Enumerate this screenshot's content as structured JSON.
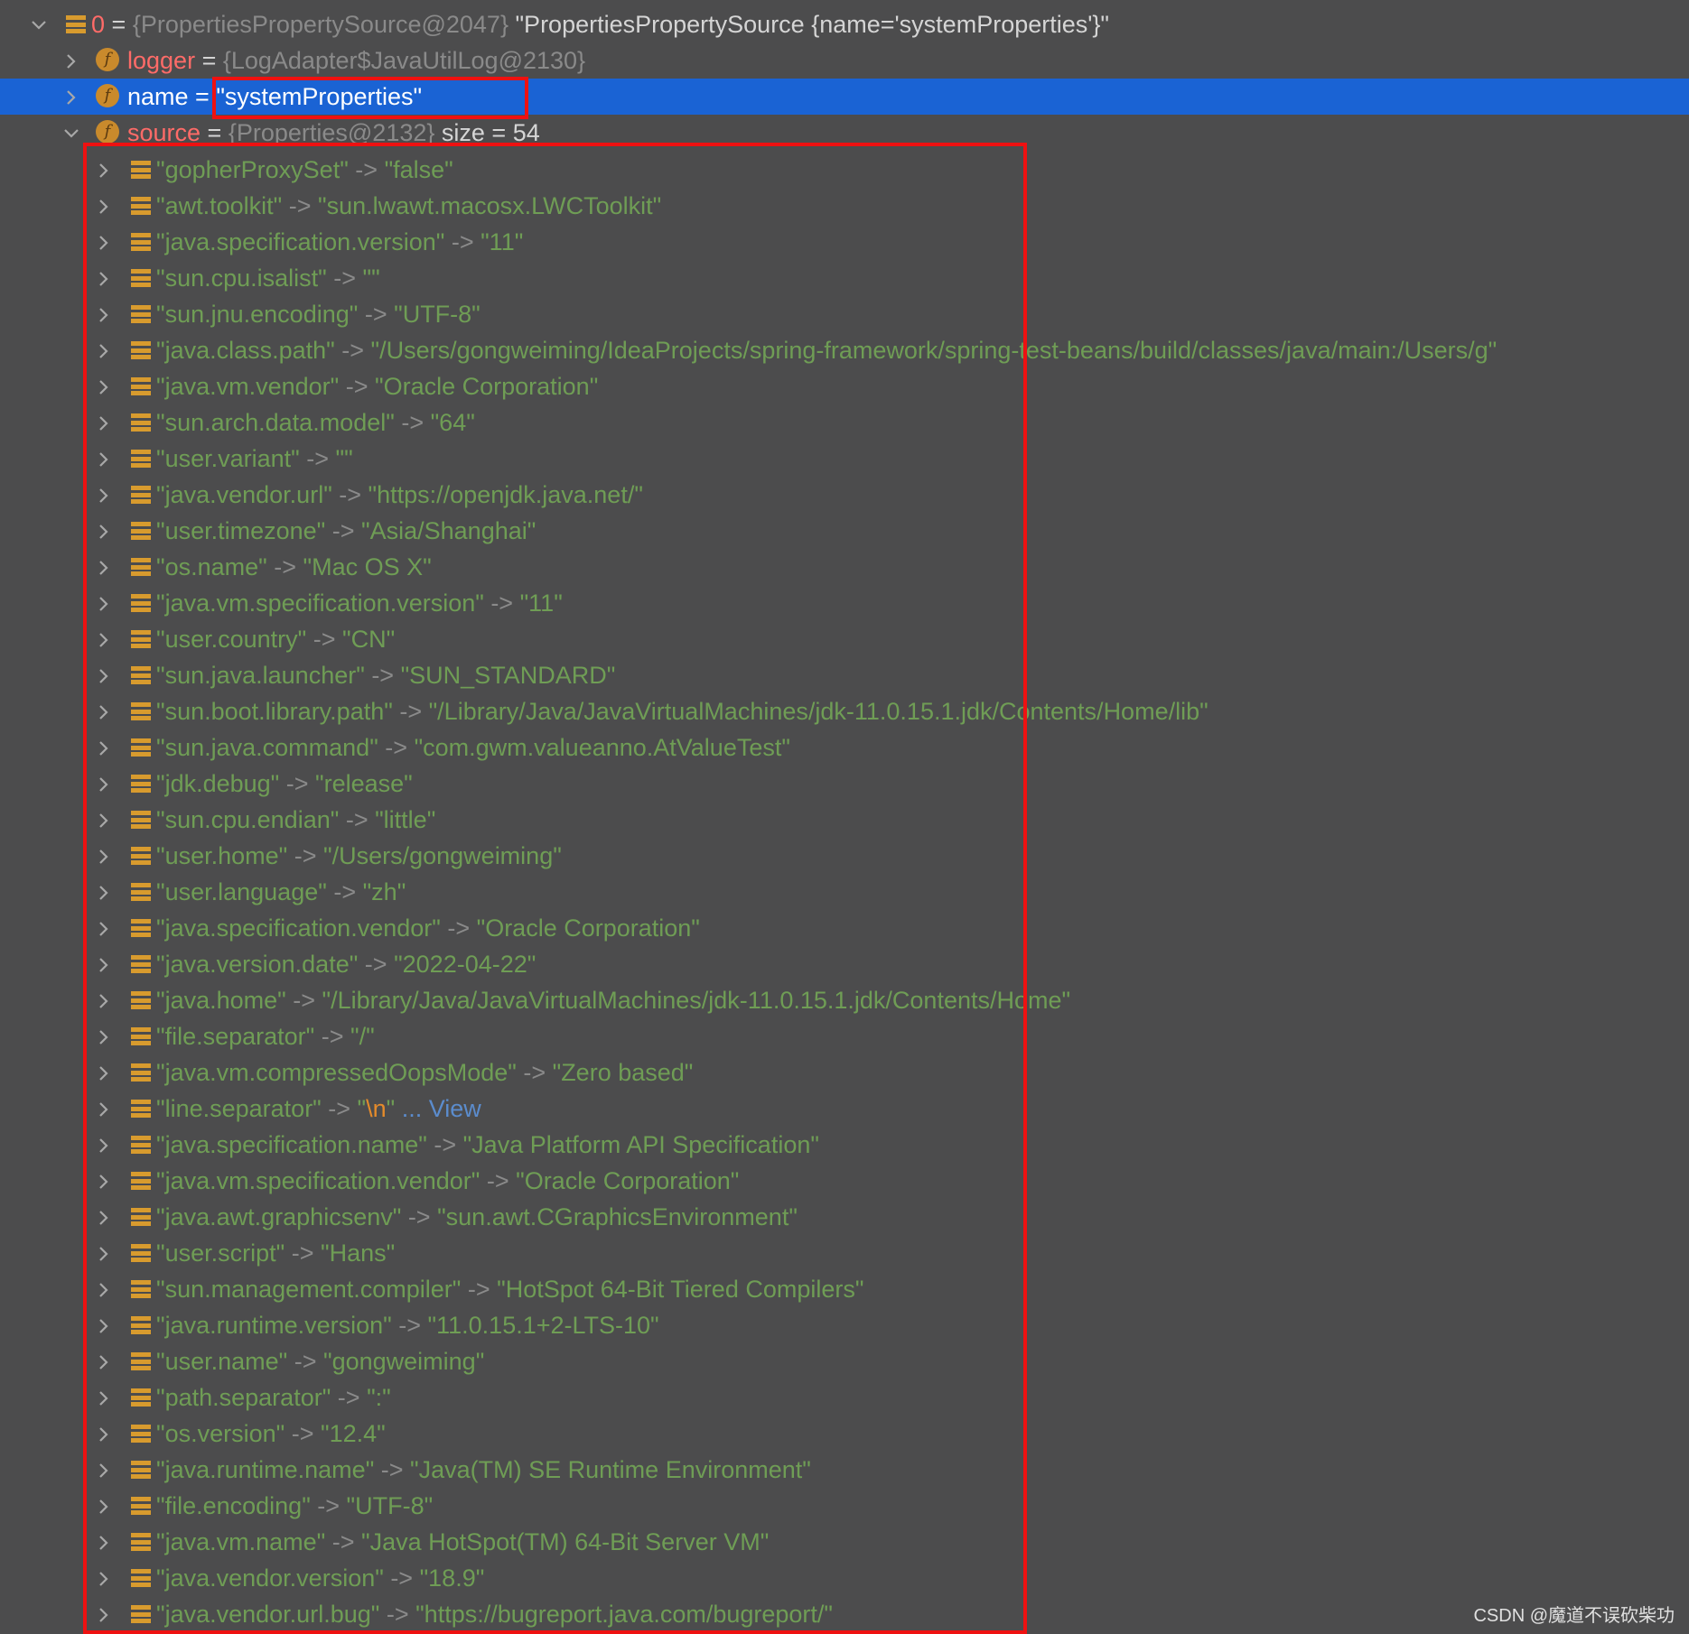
{
  "root": {
    "index": "0",
    "ref": "{PropertiesPropertySource@2047}",
    "value": "\"PropertiesPropertySource {name='systemProperties'}\""
  },
  "fields": [
    {
      "name": "logger",
      "ref": "{LogAdapter$JavaUtilLog@2130}",
      "value": "",
      "expanded": false,
      "selected": false
    },
    {
      "name": "name",
      "ref": "",
      "value": "\"systemProperties\"",
      "expanded": false,
      "selected": true
    },
    {
      "name": "source",
      "ref": "{Properties@2132}",
      "value": "size = 54",
      "expanded": true,
      "selected": false
    }
  ],
  "entries": [
    [
      "gopherProxySet",
      "false"
    ],
    [
      "awt.toolkit",
      "sun.lwawt.macosx.LWCToolkit"
    ],
    [
      "java.specification.version",
      "11"
    ],
    [
      "sun.cpu.isalist",
      ""
    ],
    [
      "sun.jnu.encoding",
      "UTF-8"
    ],
    [
      "java.class.path",
      "/Users/gongweiming/IdeaProjects/spring-framework/spring-test-beans/build/classes/java/main:/Users/g"
    ],
    [
      "java.vm.vendor",
      "Oracle Corporation"
    ],
    [
      "sun.arch.data.model",
      "64"
    ],
    [
      "user.variant",
      ""
    ],
    [
      "java.vendor.url",
      "https://openjdk.java.net/"
    ],
    [
      "user.timezone",
      "Asia/Shanghai"
    ],
    [
      "os.name",
      "Mac OS X"
    ],
    [
      "java.vm.specification.version",
      "11"
    ],
    [
      "user.country",
      "CN"
    ],
    [
      "sun.java.launcher",
      "SUN_STANDARD"
    ],
    [
      "sun.boot.library.path",
      "/Library/Java/JavaVirtualMachines/jdk-11.0.15.1.jdk/Contents/Home/lib"
    ],
    [
      "sun.java.command",
      "com.gwm.valueanno.AtValueTest"
    ],
    [
      "jdk.debug",
      "release"
    ],
    [
      "sun.cpu.endian",
      "little"
    ],
    [
      "user.home",
      "/Users/gongweiming"
    ],
    [
      "user.language",
      "zh"
    ],
    [
      "java.specification.vendor",
      "Oracle Corporation"
    ],
    [
      "java.version.date",
      "2022-04-22"
    ],
    [
      "java.home",
      "/Library/Java/JavaVirtualMachines/jdk-11.0.15.1.jdk/Contents/Home"
    ],
    [
      "file.separator",
      "/"
    ],
    [
      "java.vm.compressedOopsMode",
      "Zero based"
    ],
    [
      "line.separator",
      "\\n",
      "... View"
    ],
    [
      "java.specification.name",
      "Java Platform API Specification"
    ],
    [
      "java.vm.specification.vendor",
      "Oracle Corporation"
    ],
    [
      "java.awt.graphicsenv",
      "sun.awt.CGraphicsEnvironment"
    ],
    [
      "user.script",
      "Hans"
    ],
    [
      "sun.management.compiler",
      "HotSpot 64-Bit Tiered Compilers"
    ],
    [
      "java.runtime.version",
      "11.0.15.1+2-LTS-10"
    ],
    [
      "user.name",
      "gongweiming"
    ],
    [
      "path.separator",
      ":"
    ],
    [
      "os.version",
      "12.4"
    ],
    [
      "java.runtime.name",
      "Java(TM) SE Runtime Environment"
    ],
    [
      "file.encoding",
      "UTF-8"
    ],
    [
      "java.vm.name",
      "Java HotSpot(TM) 64-Bit Server VM"
    ],
    [
      "java.vendor.version",
      "18.9"
    ],
    [
      "java.vendor.url.bug",
      "https://bugreport.java.com/bugreport/"
    ]
  ],
  "watermark": "CSDN @魔道不误砍柴功",
  "colors": {
    "background": "#4c4c4d",
    "selection": "#1a63d4",
    "string": "#6f9d55",
    "field": "#ff6b68",
    "highlight_box": "#ee1111"
  }
}
